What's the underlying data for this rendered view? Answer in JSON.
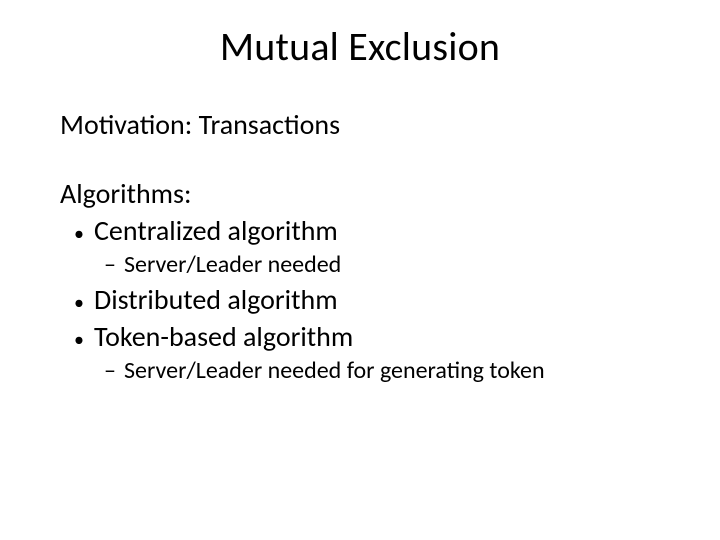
{
  "title": "Mutual Exclusion",
  "motivation": "Motivation: Transactions",
  "algorithms_heading": "Algorithms:",
  "bullets": {
    "b0": "Centralized algorithm",
    "s0": "Server/Leader needed",
    "b1": "Distributed algorithm",
    "b2": "Token-based algorithm",
    "s1": "Server/Leader needed for generating token"
  }
}
